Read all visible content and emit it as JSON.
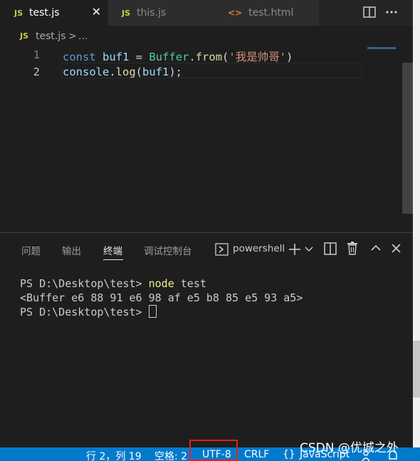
{
  "tabs": [
    {
      "badge": "JS",
      "label": "test.js",
      "close": "✕"
    },
    {
      "badge": "JS",
      "label": "this.js"
    },
    {
      "badge": "<>",
      "label": "test.html"
    }
  ],
  "breadcrumb": {
    "badge": "JS",
    "file": "test.js",
    "separator": ">",
    "rest": "..."
  },
  "editor": {
    "line_numbers": [
      "1",
      "2"
    ],
    "line1": {
      "kw": "const",
      "name": "buf1",
      "eq": "=",
      "cls": "Buffer",
      "dot": ".",
      "fn": "from",
      "open": "(",
      "str": "'我是帅哥'",
      "close": ")"
    },
    "line2": {
      "obj": "console",
      "dot": ".",
      "fn": "log",
      "open": "(",
      "arg": "buf1",
      "close": ");"
    }
  },
  "panel": {
    "tabs": [
      "问题",
      "输出",
      "终端",
      "调试控制台"
    ],
    "active_tab": "终端",
    "shell": "powershell"
  },
  "terminal": {
    "prompt1": "PS D:\\Desktop\\test> ",
    "cmd": "node",
    "cmd_arg": " test",
    "output": "<Buffer e6 88 91 e6 98 af e5 b8 85 e5 93 a5>",
    "prompt2": "PS D:\\Desktop\\test> "
  },
  "statusbar": {
    "position": "行 2，列 19",
    "spaces": "空格: 2",
    "encoding": "UTF-8",
    "eol": "CRLF",
    "lang_icon": "{}",
    "language": "JavaScript"
  },
  "watermark": "CSDN @优城之外",
  "colors": {
    "accent": "#007acc",
    "highlight_box": "#e02020",
    "js_badge": "#cbcb41",
    "html_badge": "#e37933"
  }
}
